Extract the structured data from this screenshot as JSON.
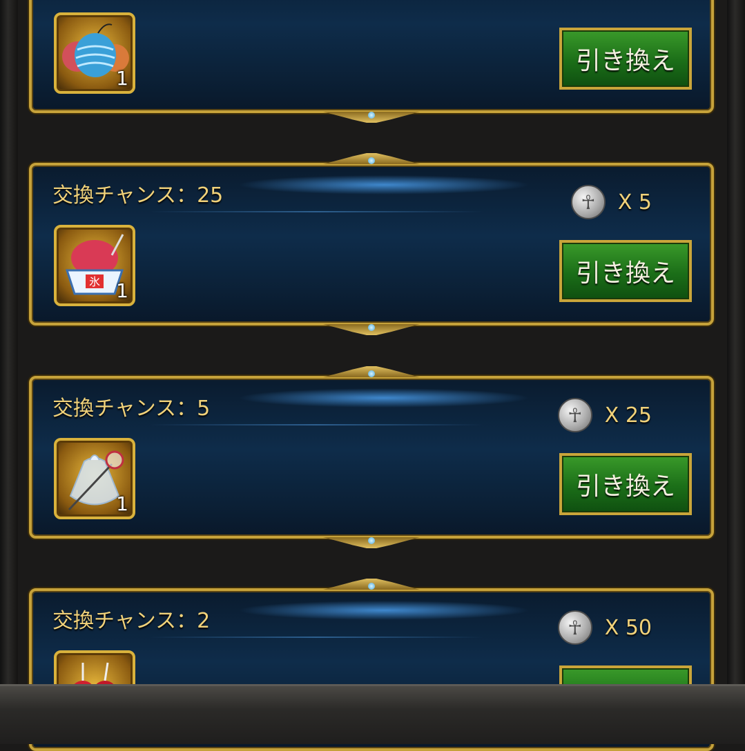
{
  "chance_label": "交換チャンス：",
  "redeem_label": "引き換え",
  "cards": [
    {
      "chance": "",
      "cost": "",
      "item": "water-balloon",
      "qty": "1"
    },
    {
      "chance": "交換チャンス：25",
      "cost": "X 5",
      "item": "shaved-ice",
      "qty": "1"
    },
    {
      "chance": "交換チャンス：5",
      "cost": "X 25",
      "item": "goldfish-bag",
      "qty": "1"
    },
    {
      "chance": "交換チャンス：2",
      "cost": "X 50",
      "item": "candy-apple",
      "qty": ""
    }
  ],
  "coin_icon": "ankh-coin",
  "colors": {
    "gold": "#c6a23a",
    "text_gold": "#f1d27a",
    "button_green": "#1b6e18"
  }
}
